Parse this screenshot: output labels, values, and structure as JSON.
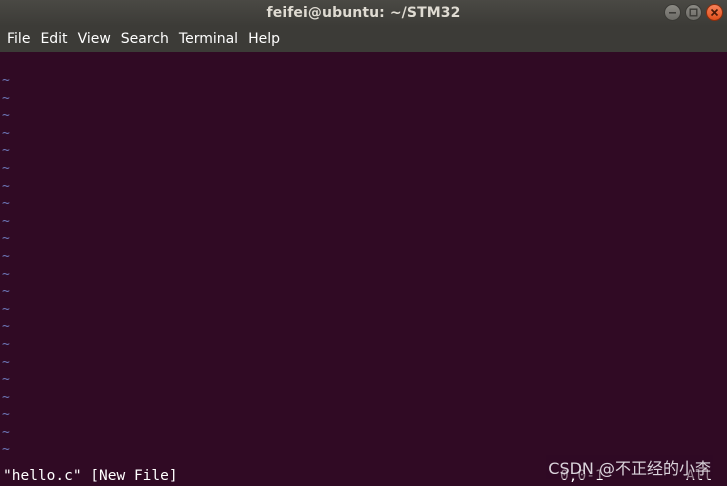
{
  "window": {
    "title": "feifei@ubuntu: ~/STM32"
  },
  "menubar": {
    "items": [
      "File",
      "Edit",
      "View",
      "Search",
      "Terminal",
      "Help"
    ]
  },
  "terminal": {
    "empty_line_marker": "~",
    "empty_line_count": 22,
    "status": {
      "file_info": "\"hello.c\" [New File]",
      "position": "0,0-1",
      "scroll": "All"
    },
    "colors": {
      "background": "#300a24",
      "tilde": "#6d77b8",
      "text": "#ffffff"
    }
  },
  "watermark": {
    "text": "CSDN @不正经的小李"
  }
}
